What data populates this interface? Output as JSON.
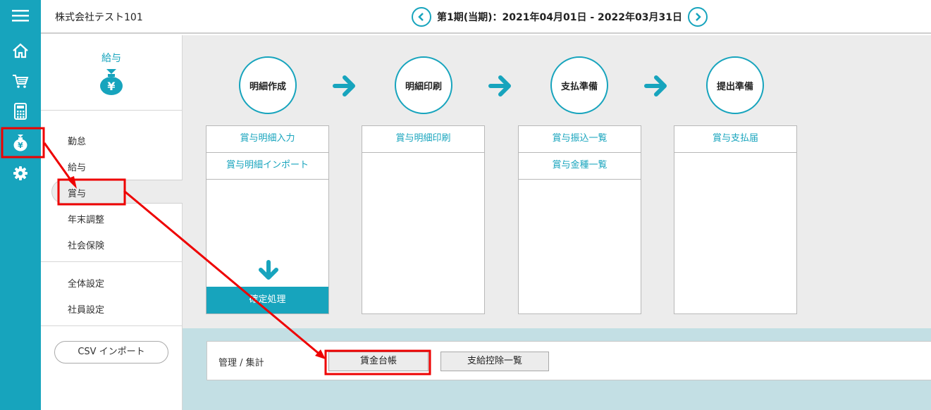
{
  "header": {
    "company": "株式会社テスト101",
    "period": "第1期(当期)：2021年04月01日 - 2022年03月31日"
  },
  "rail": {
    "icons": [
      "menu-icon",
      "home-icon",
      "cart-icon",
      "calculator-icon",
      "money-bag-icon",
      "gear-icon"
    ]
  },
  "sidemenu": {
    "title": "給与",
    "items": [
      {
        "label": "勤怠"
      },
      {
        "label": "給与"
      },
      {
        "label": "賞与"
      },
      {
        "label": "年末調整"
      },
      {
        "label": "社会保険"
      },
      {
        "label": "全体設定"
      },
      {
        "label": "社員設定"
      }
    ],
    "active": "賞与",
    "csv_label": "CSV インポート"
  },
  "workflow": {
    "steps": [
      {
        "label": "明細作成",
        "items": [
          "賞与明細入力",
          "賞与明細インポート"
        ],
        "action": "確定処理"
      },
      {
        "label": "明細印刷",
        "items": [
          "賞与明細印刷"
        ]
      },
      {
        "label": "支払準備",
        "items": [
          "賞与振込一覧",
          "賞与金種一覧"
        ]
      },
      {
        "label": "提出準備",
        "items": [
          "賞与支払届"
        ]
      }
    ]
  },
  "management": {
    "label": "管理 / 集計",
    "buttons": [
      "賃金台帳",
      "支給控除一覧"
    ]
  },
  "colors": {
    "accent": "#17a4bd",
    "annotation": "#ee0000",
    "panel_bg": "#ececec",
    "lower_bg": "#c3dfe4"
  }
}
